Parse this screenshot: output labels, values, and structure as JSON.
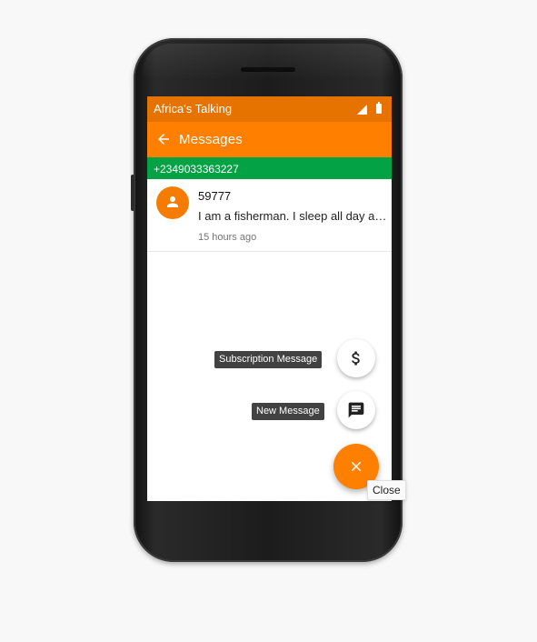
{
  "status_bar": {
    "app_name": "Africa's Talking",
    "icons": [
      "signal-icon",
      "battery-icon"
    ]
  },
  "app_bar": {
    "back_icon": "arrow-back-icon",
    "title": "Messages"
  },
  "number_bar": {
    "phone_number": "+2349033363227"
  },
  "messages": [
    {
      "avatar_icon": "person-icon",
      "sender": "59777",
      "preview": "I am a fisherman. I sleep all day and fish all night.",
      "time": "15 hours ago"
    }
  ],
  "speed_dial": {
    "subscription": {
      "label": "Subscription Message",
      "icon": "dollar-icon"
    },
    "new_message": {
      "label": "New Message",
      "icon": "message-icon"
    },
    "close": {
      "tooltip": "Close",
      "icon": "close-icon"
    }
  },
  "colors": {
    "status_bar": "#e67300",
    "app_bar": "#ff7f00",
    "number_bar": "#03a245",
    "avatar": "#f57c00",
    "fab": "#ff7f00"
  }
}
